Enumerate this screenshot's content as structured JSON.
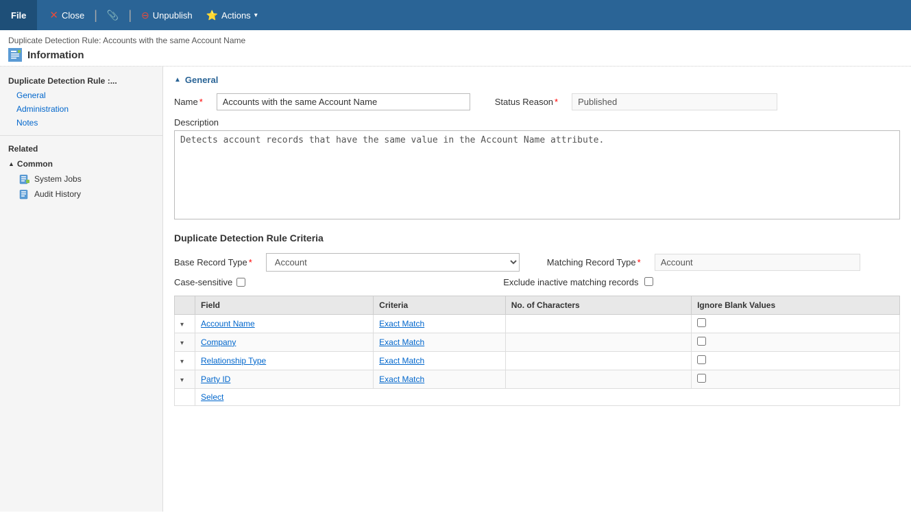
{
  "toolbar": {
    "file_label": "File",
    "close_label": "Close",
    "attachment_label": "",
    "unpublish_label": "Unpublish",
    "actions_label": "Actions"
  },
  "header": {
    "breadcrumb": "Duplicate Detection Rule: Accounts with the same Account Name",
    "title": "Information",
    "icon_text": "i"
  },
  "sidebar": {
    "section_title": "Duplicate Detection Rule :...",
    "nav_items": [
      {
        "label": "General",
        "id": "general"
      },
      {
        "label": "Administration",
        "id": "administration"
      },
      {
        "label": "Notes",
        "id": "notes"
      }
    ],
    "related_title": "Related",
    "common_header": "Common",
    "common_items": [
      {
        "label": "System Jobs",
        "id": "system-jobs"
      },
      {
        "label": "Audit History",
        "id": "audit-history"
      }
    ]
  },
  "general": {
    "section_label": "General",
    "name_label": "Name",
    "name_value": "Accounts with the same Account Name",
    "status_reason_label": "Status Reason",
    "status_reason_value": "Published",
    "description_label": "Description",
    "description_value": "Detects account records that have the same value in the Account Name attribute."
  },
  "criteria": {
    "section_title": "Duplicate Detection Rule Criteria",
    "base_record_type_label": "Base Record Type",
    "base_record_type_value": "Account",
    "matching_record_type_label": "Matching Record Type",
    "matching_record_type_value": "Account",
    "case_sensitive_label": "Case-sensitive",
    "exclude_label": "Exclude inactive matching records",
    "table": {
      "columns": [
        "Field",
        "Criteria",
        "No. of Characters",
        "Ignore Blank Values"
      ],
      "rows": [
        {
          "expand": "▾",
          "field": "Account Name",
          "criteria": "Exact Match",
          "no_of_chars": "",
          "ignore_blank": false
        },
        {
          "expand": "▾",
          "field": "Company",
          "criteria": "Exact Match",
          "no_of_chars": "",
          "ignore_blank": false
        },
        {
          "expand": "▾",
          "field": "Relationship Type",
          "criteria": "Exact Match",
          "no_of_chars": "",
          "ignore_blank": false
        },
        {
          "expand": "▾",
          "field": "Party ID",
          "criteria": "Exact Match",
          "no_of_chars": "",
          "ignore_blank": false
        }
      ],
      "select_label": "Select"
    }
  }
}
